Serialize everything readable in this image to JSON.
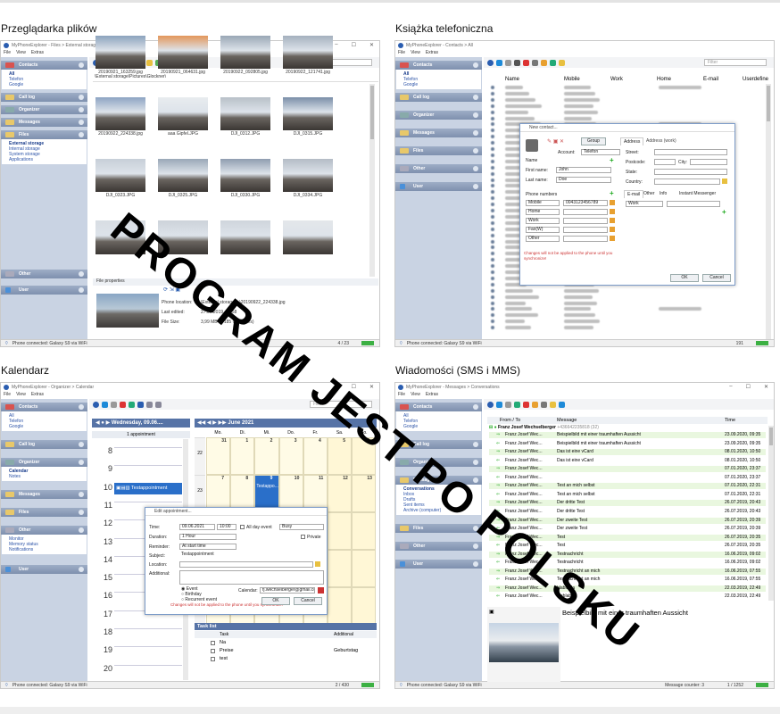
{
  "captions": {
    "files": "Przeglądarka plików",
    "contacts": "Książka telefoniczna",
    "calendar": "Kalendarz",
    "messages": "Wiadomości (SMS i MMS)"
  },
  "watermark": "PROGRAM JEST PO POLSKU",
  "menu": {
    "file": "File",
    "view": "View",
    "extras": "Extras"
  },
  "sidebar": {
    "contacts": "Contacts",
    "contacts_sub": [
      "All",
      "Telefon",
      "Google"
    ],
    "calllog": "Call log",
    "organizer": "Organizer",
    "organizer_sub": [
      "Calendar",
      "Notes"
    ],
    "messages": "Messages",
    "messages_sub": [
      "Conversations",
      "Inbox",
      "Drafts",
      "Sent items",
      "Archive (computer)"
    ],
    "files": "Files",
    "files_sub": [
      "External storage",
      "Internal storage",
      "System storage",
      "Applications"
    ],
    "other": "Other",
    "other_sub": [
      "Monitor",
      "Memory status",
      "Notifications"
    ],
    "user": "User"
  },
  "search_placeholder": "Filter",
  "files_win": {
    "title": "MyPhoneExplorer - Files > External storage\\Pictures\\Glockner",
    "path": "\\External storage\\Pictures\\Glockner\\",
    "thumbs": [
      "20190921_163259.jpg",
      "20190921_064631.jpg",
      "20190922_092805.jpg",
      "20190922_121741.jpg",
      "20190922_224338.jpg",
      "aaa Gipfel.JPG",
      "DJI_0312.JPG",
      "DJI_0315.JPG",
      "DJI_0323.JPG",
      "DJI_0325.JPG",
      "DJI_0330.JPG",
      "DJI_0334.JPG",
      "",
      "",
      "",
      ""
    ],
    "props_title": "File properties",
    "props": [
      {
        "k": "Phone location:",
        "v": "\\External storage\\...\\20190922_224338.jpg"
      },
      {
        "k": "Last edited:",
        "v": "27.09.2019, 18:58"
      },
      {
        "k": "File Size:",
        "v": "3,99 MB (4 185 619 Bytes)"
      }
    ],
    "status": "Phone connected: Galaxy S9 via WiFi",
    "count": "4 / 23"
  },
  "contacts_win": {
    "title": "MyPhoneExplorer - Contacts > All",
    "cols": [
      "Name",
      "Mobile",
      "Work",
      "Home",
      "E-mail",
      "Userdefine"
    ],
    "dialog": {
      "title": "New contact...",
      "group_btn": "Group",
      "account_label": "Account:",
      "account_value": "Telefon",
      "name_label": "Name",
      "first_label": "First name:",
      "first_value": "John",
      "last_label": "Last name:",
      "last_value": "Doe",
      "phones_label": "Phone numbers",
      "phone_types": [
        "Mobile",
        "Home",
        "Work",
        "Fax(W)",
        "Other"
      ],
      "mobile_value": "0043123456789",
      "warning": "Changes will not be applied to the phone until you synchronize!",
      "tab_address": "Address",
      "tab_address_work": "Address (work)",
      "street": "Street:",
      "postcode": "Postcode:",
      "city": "City:",
      "state": "State:",
      "country": "Country:",
      "tab_email": "E-mail",
      "tab_other": "Other",
      "tab_info": "Info",
      "tab_im": "Instant Messenger",
      "email_type": "Work",
      "ok": "OK",
      "cancel": "Cancel"
    },
    "status": "Phone connected: Galaxy S9 via WiFi",
    "count": "191"
  },
  "calendar_win": {
    "title": "MyPhoneExplorer - Organizer > Calendar",
    "day_header": "Wednesday, 09.06....",
    "all_day": "1 appointment",
    "hours": [
      "8",
      "9",
      "10",
      "11",
      "12",
      "13",
      "14",
      "15",
      "16",
      "17",
      "18",
      "19",
      "20"
    ],
    "appointment": "Testappointment",
    "month_header": "June 2021",
    "weekdays": [
      "Mo.",
      "Di.",
      "Mi.",
      "Do.",
      "Fr.",
      "Sa.",
      "So."
    ],
    "weeks": [
      "22",
      "23",
      "24",
      "25",
      "26"
    ],
    "days_row1": [
      "31",
      "1",
      "2",
      "3",
      "4",
      "5",
      "6"
    ],
    "days_row2": [
      "7",
      "8",
      "9",
      "10",
      "11",
      "12",
      "13"
    ],
    "small_appt": "Testappo...",
    "edit": {
      "title": "Edit appointment...",
      "time_label": "Time:",
      "date": "09.06.2021",
      "time": "10:00",
      "allday": "All day event",
      "busy": "Busy",
      "duration_label": "Duration:",
      "duration": "1 Hour",
      "private": "Private",
      "reminder_label": "Reminder:",
      "reminder": "At start time",
      "subject_label": "Subject:",
      "subject": "Testappointment",
      "location_label": "Location:",
      "additional_label": "Additional:",
      "types": [
        "Event",
        "Birthday",
        "Recurrent event"
      ],
      "calendar_label": "Calendar:",
      "calendar": "fj.wechselberger@gmail.com",
      "warning": "Changes will not be applied to the phone until you synchronize!",
      "ok": "OK",
      "cancel": "Cancel"
    },
    "tasks_title": "Task list",
    "tasks_cols": [
      "Task",
      "Additional"
    ],
    "tasks": [
      {
        "t": "Na",
        "a": ""
      },
      {
        "t": "Preise",
        "a": "Geburtstag"
      },
      {
        "t": "test",
        "a": ""
      }
    ],
    "status": "Phone connected: Galaxy S9 via WiFi",
    "count": "2 / 430"
  },
  "messages_win": {
    "title": "MyPhoneExplorer - Messages > Conversations",
    "cols": [
      "From / To",
      "Message",
      "Time"
    ],
    "group": "Franz Josef Wechselberger",
    "group_num": "+436642235818 (32)",
    "rows": [
      {
        "from": "Franz Josef Wec...",
        "msg": "Beispielbild mit einer traumhaften Aussicht",
        "time": "23.09.2020, 09:35"
      },
      {
        "from": "Franz Josef Wec...",
        "msg": "Beispielbild mit einer traumhaften Aussicht",
        "time": "23.09.2020, 09:35"
      },
      {
        "from": "Franz Josef Wec...",
        "msg": "Das ist eine vCard",
        "time": "08.01.2020, 10:50"
      },
      {
        "from": "Franz Josef Wec...",
        "msg": "Das ist eine vCard",
        "time": "08.01.2020, 10:50"
      },
      {
        "from": "Franz Josef Wec...",
        "msg": "",
        "time": "07.01.2020, 23:37"
      },
      {
        "from": "Franz Josef Wec...",
        "msg": "",
        "time": "07.01.2020, 23:37"
      },
      {
        "from": "Franz Josef Wec...",
        "msg": "Test an mich selbst",
        "time": "07.01.2020, 22:31"
      },
      {
        "from": "Franz Josef Wec...",
        "msg": "Test an mich selbst",
        "time": "07.01.2020, 22:31"
      },
      {
        "from": "Franz Josef Wec...",
        "msg": "Der dritte Test",
        "time": "26.07.2019, 20:43"
      },
      {
        "from": "Franz Josef Wec...",
        "msg": "Der dritte Test",
        "time": "26.07.2019, 20:43"
      },
      {
        "from": "Franz Josef Wec...",
        "msg": "Der zweite Test",
        "time": "26.07.2019, 20:39"
      },
      {
        "from": "Franz Josef Wec...",
        "msg": "Der zweite Test",
        "time": "26.07.2019, 20:39"
      },
      {
        "from": "Franz Josef Wec...",
        "msg": "Test",
        "time": "26.07.2019, 20:35"
      },
      {
        "from": "Franz Josef Wec...",
        "msg": "Test",
        "time": "26.07.2019, 20:35"
      },
      {
        "from": "Franz Josef Wec...",
        "msg": "Testnachricht",
        "time": "16.06.2019, 09:02"
      },
      {
        "from": "Franz Josef Wec...",
        "msg": "Testnachricht",
        "time": "16.06.2019, 09:02"
      },
      {
        "from": "Franz Josef Wec...",
        "msg": "Testnachricht an mich",
        "time": "16.06.2019, 07:55"
      },
      {
        "from": "Franz Josef Wec...",
        "msg": "Testnachricht an mich",
        "time": "16.06.2019, 07:55"
      },
      {
        "from": "Franz Josef Wec...",
        "msg": "blablabla",
        "time": "22.03.2019, 22:49"
      },
      {
        "from": "Franz Josef Wec...",
        "msg": "blablabla",
        "time": "22.03.2019, 22:49"
      }
    ],
    "preview_text": "Beispielbild mit einer traumhaften Aussicht",
    "status": "Phone connected: Galaxy S9 via WiFi",
    "msgcount": "Message counter: 3",
    "count": "1 / 1252"
  }
}
